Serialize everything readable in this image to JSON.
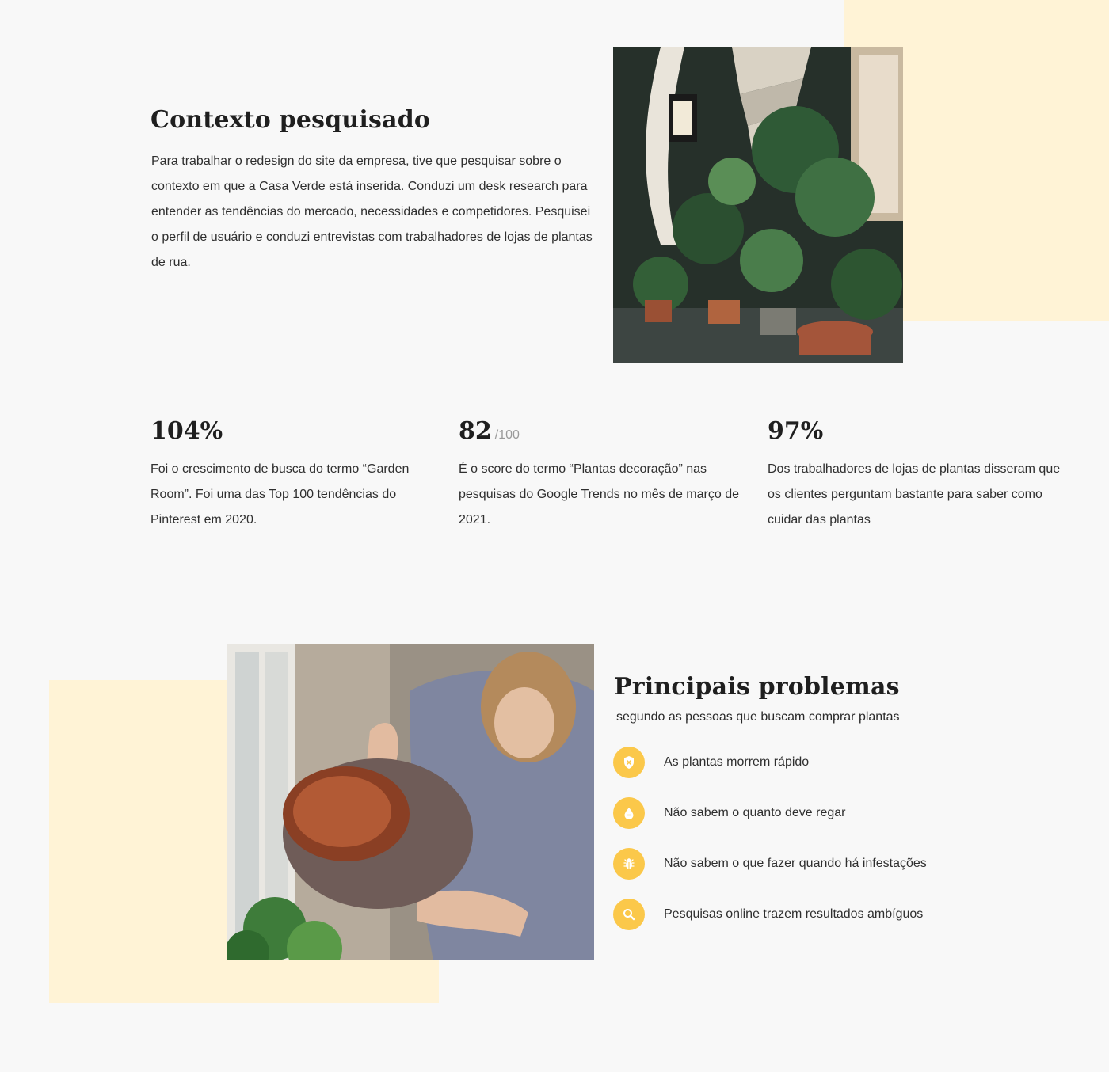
{
  "colors": {
    "background": "#f8f8f8",
    "accent_light": "#fff3d6",
    "icon_yellow": "#fbc84a",
    "text_dark": "#1f1f1f"
  },
  "context": {
    "title": "Contexto pesquisado",
    "description": "Para trabalhar o redesign do site da empresa, tive que pesquisar sobre o contexto em que a Casa Verde está inserida. Conduzi um desk research para entender as tendências do mercado, necessidades e competidores. Pesquisei o perfil de usuário e conduzi entrevistas com trabalhadores de lojas de plantas de rua."
  },
  "stats": [
    {
      "value": "104%",
      "suffix": "",
      "description": "Foi o crescimento de busca do termo “Garden Room”. Foi uma das Top 100 tendências do Pinterest em 2020."
    },
    {
      "value": "82",
      "suffix": "/100",
      "description": "É o score do termo “Plantas decoração” nas pesquisas do Google Trends no mês de março de 2021."
    },
    {
      "value": "97%",
      "suffix": "",
      "description": "Dos trabalhadores de lojas de plantas disseram que os clientes perguntam bastante para saber como cuidar das plantas"
    }
  ],
  "problems": {
    "title": "Principais problemas",
    "subtitle": "segundo as pessoas que buscam comprar plantas",
    "items": [
      {
        "icon": "shield-x-icon",
        "label": "As plantas morrem rápido"
      },
      {
        "icon": "water-drop-icon",
        "label": "Não sabem o quanto deve regar"
      },
      {
        "icon": "bug-icon",
        "label": "Não sabem o que fazer quando há infestações"
      },
      {
        "icon": "search-icon",
        "label": "Pesquisas online trazem resultados ambíguos"
      }
    ]
  }
}
